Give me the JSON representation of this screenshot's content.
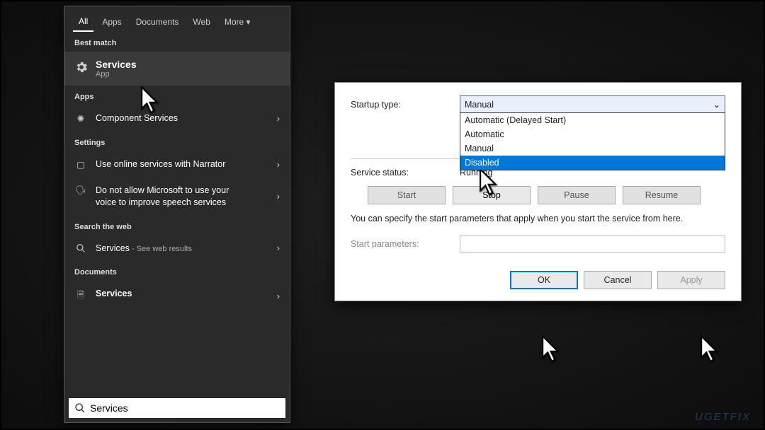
{
  "startmenu": {
    "tabs": [
      "All",
      "Apps",
      "Documents",
      "Web",
      "More"
    ],
    "active_tab": "All",
    "best_match_label": "Best match",
    "best_match_title": "Services",
    "best_match_sub": "App",
    "apps_label": "Apps",
    "app_item": "Component Services",
    "settings_label": "Settings",
    "setting1": "Use online services with Narrator",
    "setting2": "Do not allow Microsoft to use your voice to improve speech services",
    "web_label": "Search the web",
    "web_item": "Services",
    "web_sub": " - See web results",
    "docs_label": "Documents",
    "doc_item": "Services",
    "search_value": "Services"
  },
  "dialog": {
    "startup_label": "Startup type:",
    "startup_selected": "Manual",
    "options": [
      "Automatic (Delayed Start)",
      "Automatic",
      "Manual",
      "Disabled"
    ],
    "status_label": "Service status:",
    "status_value": "Running",
    "buttons": {
      "start": "Start",
      "stop": "Stop",
      "pause": "Pause",
      "resume": "Resume"
    },
    "help_text": "You can specify the start parameters that apply when you start the service from here.",
    "param_label": "Start parameters:",
    "param_value": "",
    "ok": "OK",
    "cancel": "Cancel",
    "apply": "Apply"
  },
  "watermark": "UGETFIX"
}
